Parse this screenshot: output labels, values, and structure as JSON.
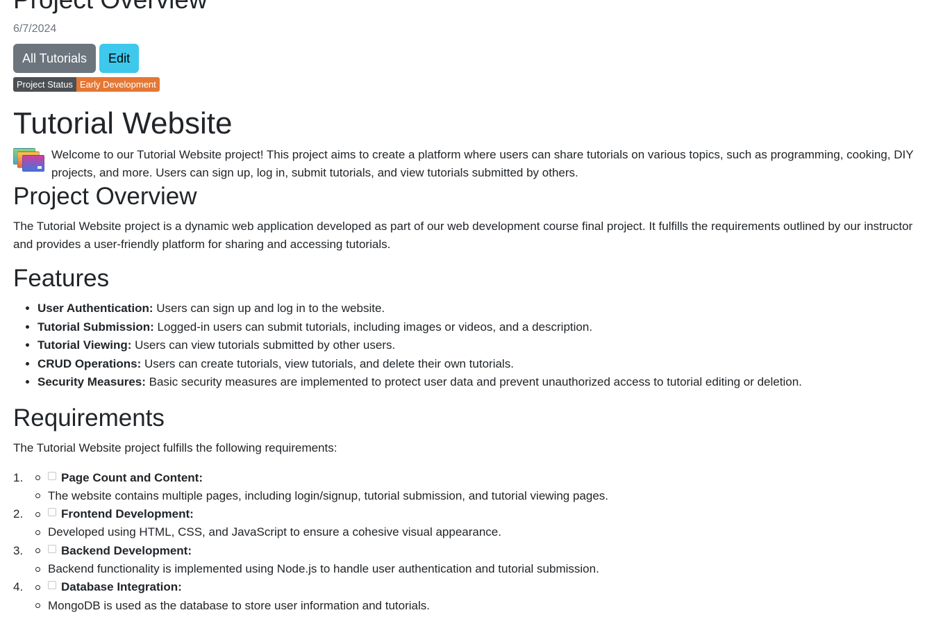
{
  "header": {
    "title": "Project Overview",
    "date": "6/7/2024"
  },
  "buttons": {
    "all_tutorials": "All Tutorials",
    "edit": "Edit"
  },
  "status": {
    "label": "Project Status",
    "value": "Early Development",
    "label_color": "#4b5054",
    "value_color": "#e57734"
  },
  "project": {
    "name": "Tutorial Website",
    "icon": "windows-cards-icon",
    "intro": "Welcome to our Tutorial Website project! This project aims to create a platform where users can share tutorials on various topics, such as programming, cooking, DIY projects, and more. Users can sign up, log in, submit tutorials, and view tutorials submitted by others."
  },
  "overview": {
    "heading": "Project Overview",
    "text": "The Tutorial Website project is a dynamic web application developed as part of our web development course final project. It fulfills the requirements outlined by our instructor and provides a user-friendly platform for sharing and accessing tutorials."
  },
  "features": {
    "heading": "Features",
    "items": [
      {
        "title": "User Authentication:",
        "desc": " Users can sign up and log in to the website."
      },
      {
        "title": "Tutorial Submission:",
        "desc": " Logged-in users can submit tutorials, including images or videos, and a description."
      },
      {
        "title": "Tutorial Viewing:",
        "desc": " Users can view tutorials submitted by other users."
      },
      {
        "title": "CRUD Operations:",
        "desc": " Users can create tutorials, view tutorials, and delete their own tutorials."
      },
      {
        "title": "Security Measures:",
        "desc": " Basic security measures are implemented to protect user data and prevent unauthorized access to tutorial editing or deletion."
      }
    ]
  },
  "requirements": {
    "heading": "Requirements",
    "intro": "The Tutorial Website project fulfills the following requirements:",
    "items": [
      {
        "num": "1.",
        "title": "Page Count and Content:",
        "desc": "The website contains multiple pages, including login/signup, tutorial submission, and tutorial viewing pages."
      },
      {
        "num": "2.",
        "title": "Frontend Development:",
        "desc": "Developed using HTML, CSS, and JavaScript to ensure a cohesive visual appearance."
      },
      {
        "num": "3.",
        "title": "Backend Development:",
        "desc": "Backend functionality is implemented using Node.js to handle user authentication and tutorial submission."
      },
      {
        "num": "4.",
        "title": "Database Integration:",
        "desc": "MongoDB is used as the database to store user information and tutorials."
      }
    ]
  }
}
